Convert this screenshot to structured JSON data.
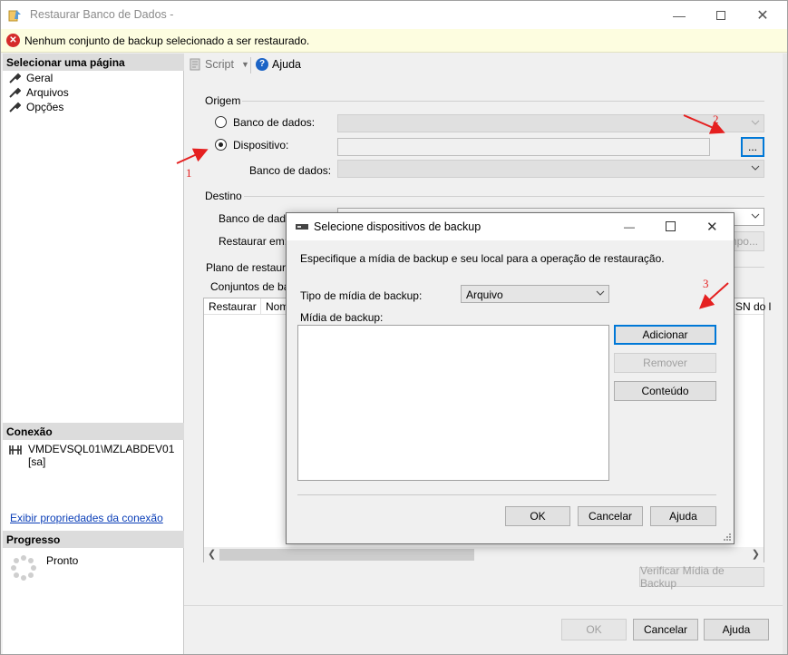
{
  "window": {
    "title": "Restaurar Banco de Dados -",
    "error_message": "Nenhum conjunto de backup selecionado a ser restaurado."
  },
  "left_pane": {
    "select_page_header": "Selecionar uma página",
    "pages": [
      {
        "label": "Geral"
      },
      {
        "label": "Arquivos"
      },
      {
        "label": "Opções"
      }
    ],
    "connection_header": "Conexão",
    "connection_server": "VMDEVSQL01\\MZLABDEV01",
    "connection_user": "[sa]",
    "connection_link": "Exibir propriedades da conexão",
    "progress_header": "Progresso",
    "progress_status": "Pronto"
  },
  "toolbar": {
    "script_label": "Script",
    "help_label": "Ajuda"
  },
  "main": {
    "origin_label": "Origem",
    "radio_database": "Banco de dados:",
    "radio_device": "Dispositivo:",
    "device_value": "",
    "device_browse": "...",
    "origin_database_label": "Banco de dados:",
    "destination_label": "Destino",
    "dest_database_label": "Banco de dados",
    "restore_to_label": "Restaurar em:",
    "restore_to_button": "mpo...",
    "restore_plan_label": "Plano de restaura",
    "backup_sets_label": "Conjuntos de back",
    "grid_columns": [
      "Restaurar",
      "Nome",
      "SN do l"
    ],
    "verify_button": "Verificar Mídia de Backup",
    "ok_button": "OK",
    "cancel_button": "Cancelar",
    "help_button": "Ajuda"
  },
  "dialog": {
    "title": "Selecione dispositivos de backup",
    "description": "Especifique a mídia de backup e seu local para a operação de restauração.",
    "media_type_label": "Tipo de mídia de backup:",
    "media_type_value": "Arquivo",
    "media_label": "Mídia de backup:",
    "add_button": "Adicionar",
    "remove_button": "Remover",
    "contents_button": "Conteúdo",
    "ok_button": "OK",
    "cancel_button": "Cancelar",
    "help_button": "Ajuda"
  },
  "annotations": {
    "step1": "1",
    "step2": "2",
    "step3": "3"
  },
  "colors": {
    "error_bg": "#fdfde0",
    "focus_border": "#0078d7",
    "annotation_red": "#e52020",
    "link": "#0b3fb8"
  }
}
